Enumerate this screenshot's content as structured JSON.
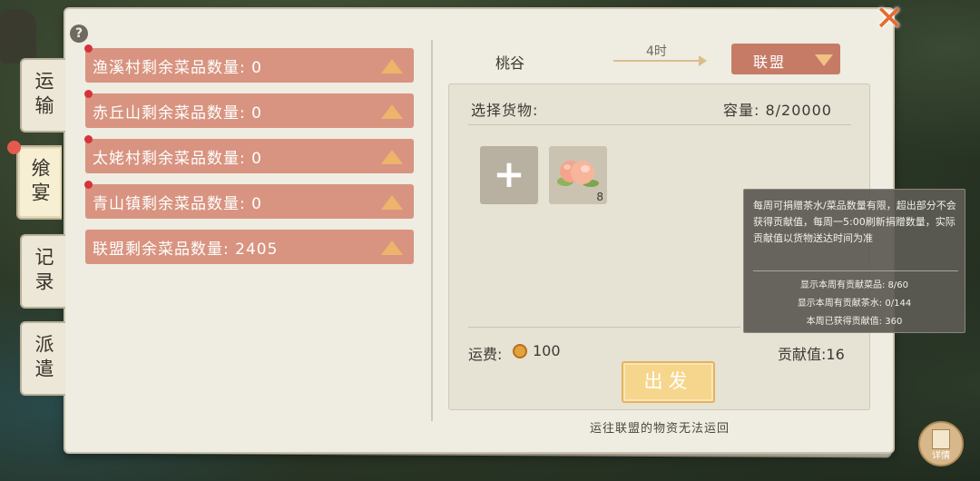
{
  "window": {
    "help_symbol": "?",
    "close_symbol": "✕"
  },
  "side_tabs": [
    {
      "label": "运输"
    },
    {
      "label": "飨宴"
    },
    {
      "label": "记录"
    },
    {
      "label": "派遣"
    }
  ],
  "stock_rows": [
    {
      "label": "渔溪村剩余菜品数量: 0"
    },
    {
      "label": "赤丘山剩余菜品数量: 0"
    },
    {
      "label": "太姥村剩余菜品数量: 0"
    },
    {
      "label": "青山镇剩余菜品数量: 0"
    },
    {
      "label": "联盟剩余菜品数量: 2405"
    }
  ],
  "route": {
    "origin": "桃谷",
    "duration": "4时",
    "destination": "联盟"
  },
  "cargo": {
    "select_label": "选择货物:",
    "capacity": "容量: 8/20000",
    "add_symbol": "+",
    "items": [
      {
        "icon": "peach-icon",
        "count": "8"
      }
    ]
  },
  "footer": {
    "fee_label": "运费:",
    "fee_value": "100",
    "contribution": "贡献值:16",
    "depart_label": "出发",
    "note": "运往联盟的物资无法运回"
  },
  "tooltip": {
    "description": "每周可捐赠茶水/菜品数量有限，超出部分不会获得贡献值，每周一5:00刷新捐赠数量，实际贡献值以货物送达时间为准",
    "stats": [
      "显示本周有贡献菜品: 8/60",
      "显示本周有贡献茶水: 0/144",
      "本周已获得贡献值: 360"
    ]
  },
  "details_button": {
    "label": "详情"
  },
  "colors": {
    "row_bg": "#d89480",
    "accent": "#c67b66",
    "depart": "#f6d68c",
    "red_dot": "#d6333b"
  }
}
